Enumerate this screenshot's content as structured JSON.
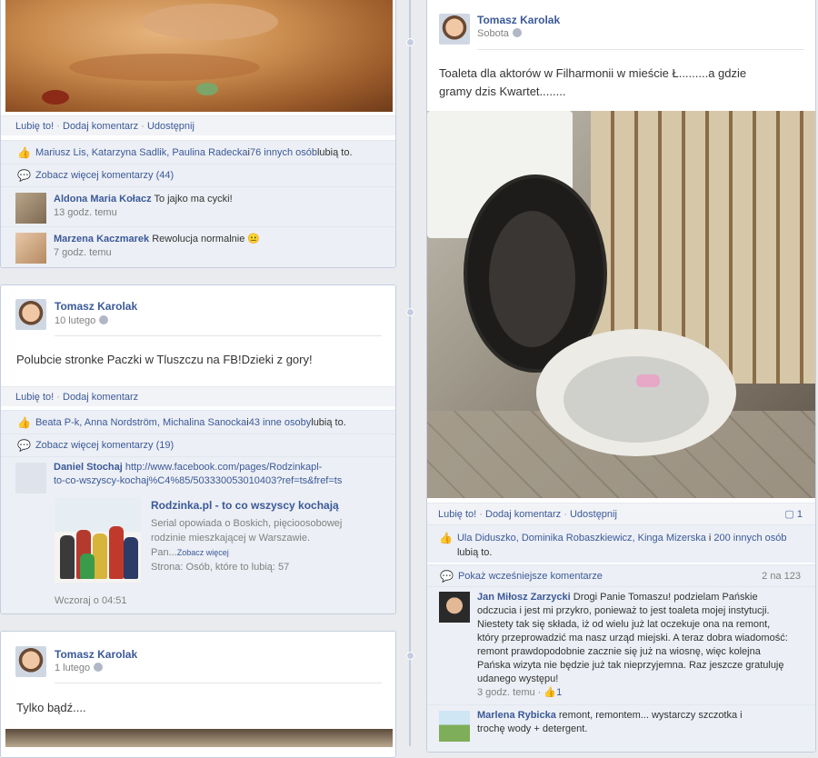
{
  "post_top": {
    "actions": {
      "like": "Lubię to!",
      "comment": "Dodaj komentarz",
      "share": "Udostępnij"
    },
    "likes_names": "Mariusz Lis, Katarzyna Sadlik, Paulina Radecka",
    "likes_and": " i ",
    "likes_more": "76 innych osób",
    "likes_suffix": " lubią to.",
    "more_comments": "Zobacz więcej komentarzy (44)",
    "comments": [
      {
        "name": "Aldona Maria Kołacz",
        "text": "To jajko ma cycki!",
        "time": "13 godz. temu"
      },
      {
        "name": "Marzena Kaczmarek",
        "text": "Rewolucja normalnie",
        "emoji": "😐",
        "time": "7 godz. temu"
      }
    ]
  },
  "post_paczki": {
    "author": "Tomasz Karolak",
    "date": "10 lutego",
    "text": "Polubcie stronke Paczki w Tluszczu na FB!Dzieki z gory!",
    "actions": {
      "like": "Lubię to!",
      "comment": "Dodaj komentarz"
    },
    "likes_names": "Beata P-k, Anna Nordström, Michalina Sanocka",
    "likes_and": " i ",
    "likes_more": "43 inne osoby",
    "likes_suffix": " lubią to.",
    "more_comments": "Zobacz więcej komentarzy (19)",
    "comment": {
      "name": "Daniel Stochaj",
      "url_line1": "http://www.facebook.com/pages/Rodzinkapl-",
      "url_line2": "to-co-wszyscy-kochaj%C4%85/503330053010403?ref=ts&fref=ts",
      "preview_title": "Rodzinka.pl - to co wszyscy kochają",
      "preview_desc1": "Serial opowiada o Boskich, pięcioosobowej",
      "preview_desc2": "rodzinie mieszkającej w Warszawie.",
      "preview_desc3": "Pan...",
      "preview_more": "Zobacz więcej",
      "preview_meta": "Strona: Osób, które to lubią: 57",
      "time": "Wczoraj o 04:51"
    }
  },
  "post_badz": {
    "author": "Tomasz Karolak",
    "date": "1 lutego",
    "text": "Tylko bądź...."
  },
  "post_toaleta": {
    "author": "Tomasz Karolak",
    "date": "Sobota",
    "text_line1": "Toaleta dla aktorów w Filharmonii w mieście Ł.........a gdzie",
    "text_line2": "gramy dzis Kwartet........",
    "actions": {
      "like": "Lubię to!",
      "comment": "Dodaj komentarz",
      "share": "Udostępnij",
      "count": "1"
    },
    "likes_line1_names": "Ula Diduszko, Dominika Robaszkiewicz, Kinga Mizerska",
    "likes_and": " i ",
    "likes_more": "200 innych osób",
    "likes_line2": "lubią to.",
    "earlier": "Pokaż wcześniejsze komentarze",
    "earlier_count": "2 na 123",
    "comments": [
      {
        "name": "Jan Miłosz Zarzycki",
        "lines": [
          "Drogi Panie Tomaszu! podzielam Pańskie",
          "odczucia i jest mi przykro, ponieważ to jest toaleta mojej instytucji.",
          "Niestety tak się składa, iż od wielu już lat oczekuje ona na remont,",
          "który przeprowadzić ma nasz urząd miejski. A teraz dobra wiadomość:",
          "remont prawdopodobnie zacznie się już na wiosnę, więc kolejna",
          "Pańska wizyta nie będzie już tak nieprzyjemna. Raz jeszcze gratuluję",
          "udanego występu!"
        ],
        "time": "3 godz. temu",
        "likes": "1"
      },
      {
        "name": "Marlena Rybicka",
        "line1": "remont, remontem... wystarczy szczotka i",
        "line2": "trochę wody + detergent."
      }
    ]
  }
}
